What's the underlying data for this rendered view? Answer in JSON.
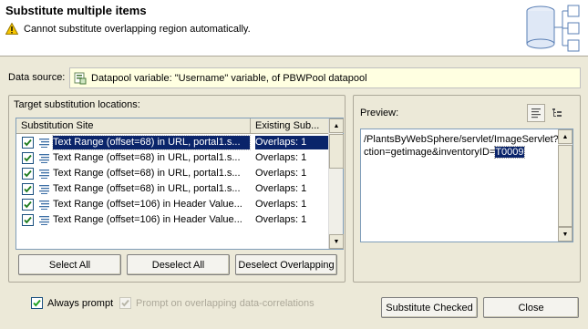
{
  "dialog": {
    "title": "Substitute multiple items",
    "message": "Cannot substitute overlapping region automatically."
  },
  "datasource": {
    "label": "Data source:",
    "value": "Datapool variable: \"Username\" variable, of PBWPool datapool"
  },
  "targets": {
    "label": "Target substitution locations:",
    "columns": [
      "Substitution Site",
      "Existing Sub..."
    ],
    "rows": [
      {
        "site": "Text Range (offset=68) in URL, portal1.s...",
        "existing": "Overlaps: 1",
        "checked": true,
        "selected": true
      },
      {
        "site": "Text Range (offset=68) in URL, portal1.s...",
        "existing": "Overlaps: 1",
        "checked": true,
        "selected": false
      },
      {
        "site": "Text Range (offset=68) in URL, portal1.s...",
        "existing": "Overlaps: 1",
        "checked": true,
        "selected": false
      },
      {
        "site": "Text Range (offset=68) in URL, portal1.s...",
        "existing": "Overlaps: 1",
        "checked": true,
        "selected": false
      },
      {
        "site": "Text Range (offset=106) in Header Value...",
        "existing": "Overlaps: 1",
        "checked": true,
        "selected": false
      },
      {
        "site": "Text Range (offset=106) in Header Value...",
        "existing": "Overlaps: 1",
        "checked": true,
        "selected": false
      }
    ],
    "buttons": {
      "select_all": "Select All",
      "deselect_all": "Deselect All",
      "deselect_overlapping": "Deselect Overlapping"
    }
  },
  "preview": {
    "label": "Preview:",
    "line1": "/PlantsByWebSphere/servlet/ImageServlet?a",
    "line2_prefix": "ction=getimage&inventoryID=",
    "line2_highlight": "T0009"
  },
  "options": {
    "always_prompt": "Always prompt",
    "prompt_overlapping": "Prompt on overlapping data-correlations"
  },
  "footer": {
    "substitute_checked": "Substitute Checked",
    "close": "Close"
  },
  "colors": {
    "selection": "#0a246a",
    "tooltip_bg": "#ffffe1",
    "dialog_bg": "#ece9d8"
  },
  "icons": [
    "warning-icon",
    "wizard-database-icon",
    "datapool-icon",
    "text-range-icon",
    "checkmark-icon"
  ]
}
